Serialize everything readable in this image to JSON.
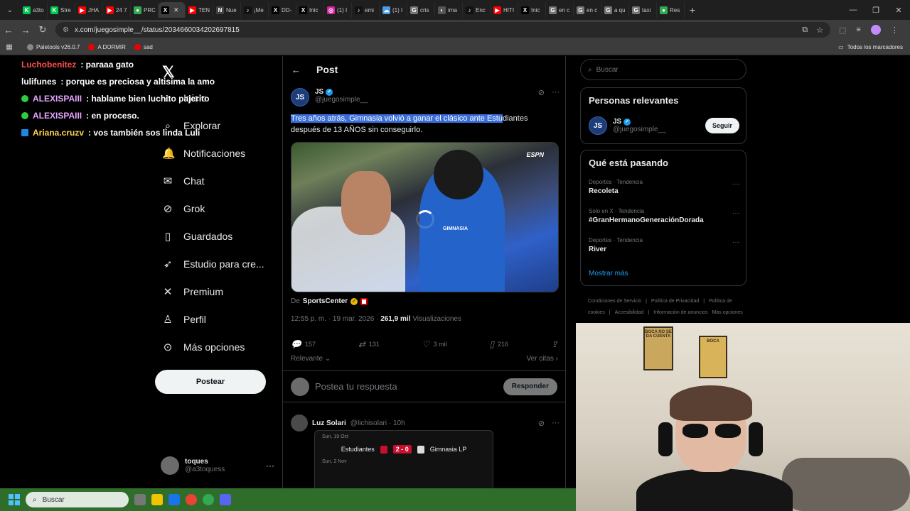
{
  "browser": {
    "tabs": [
      {
        "label": "a3to",
        "color": "#00c853",
        "glyph": "K"
      },
      {
        "label": "Stre",
        "color": "#00c853",
        "glyph": "K"
      },
      {
        "label": "JHA",
        "color": "#ff0000",
        "glyph": "▶"
      },
      {
        "label": "24 7",
        "color": "#ff0000",
        "glyph": "▶"
      },
      {
        "label": "PRC",
        "color": "#34a853",
        "glyph": "●"
      },
      {
        "label": "",
        "color": "#000000",
        "glyph": "X",
        "active": true
      },
      {
        "label": "TEN",
        "color": "#ff0000",
        "glyph": "▶"
      },
      {
        "label": "Nue",
        "color": "#444444",
        "glyph": "N"
      },
      {
        "label": "¡Me",
        "color": "#111111",
        "glyph": "♪"
      },
      {
        "label": "DD-",
        "color": "#000000",
        "glyph": "X"
      },
      {
        "label": "Inic",
        "color": "#000000",
        "glyph": "X"
      },
      {
        "label": "(1) I",
        "color": "#d6249f",
        "glyph": "◎"
      },
      {
        "label": "emi",
        "color": "#111111",
        "glyph": "♪"
      },
      {
        "label": "(1) I",
        "color": "#4b9ce2",
        "glyph": "☁"
      },
      {
        "label": "cris",
        "color": "#777777",
        "glyph": "G"
      },
      {
        "label": "ima",
        "color": "#555555",
        "glyph": "◐"
      },
      {
        "label": "Enc",
        "color": "#111111",
        "glyph": "♪"
      },
      {
        "label": "HITI",
        "color": "#ff0000",
        "glyph": "▶"
      },
      {
        "label": "Inic",
        "color": "#000000",
        "glyph": "X"
      },
      {
        "label": "en c",
        "color": "#777777",
        "glyph": "G"
      },
      {
        "label": "en c",
        "color": "#777777",
        "glyph": "G"
      },
      {
        "label": "a qu",
        "color": "#777777",
        "glyph": "G"
      },
      {
        "label": "taxi",
        "color": "#777777",
        "glyph": "G"
      },
      {
        "label": "Res",
        "color": "#34a853",
        "glyph": "●"
      }
    ],
    "url": "x.com/juegosimple__/status/2034660034202697815",
    "bookmarks": [
      {
        "label": "Paletools v26.0.7"
      },
      {
        "label": "A DORMIR"
      },
      {
        "label": "sad"
      }
    ],
    "all_bookmarks": "Todos los marcadores"
  },
  "chat": [
    {
      "user": "Luchobenitez",
      "msg": ": paraaa gato",
      "color": "#ff4d4d",
      "badge": ""
    },
    {
      "user": "lulifunes",
      "msg": ": porque es preciosa y altisima la amo",
      "color": "#ffffff",
      "badge": ""
    },
    {
      "user": "ALEXISPAIII",
      "msg": ": hablame bien luchito pajerito",
      "color": "#e5a6ff",
      "badge": "round"
    },
    {
      "user": "ALEXISPAIII",
      "msg": ": en proceso.",
      "color": "#e5a6ff",
      "badge": "round"
    },
    {
      "user": "Ariana.cruzv",
      "msg": ": vos también sos linda Luli",
      "color": "#ffd54f",
      "badge": "square"
    }
  ],
  "nav": {
    "items": [
      {
        "label": "Inicio",
        "icon": "home-icon",
        "glyph": "⌂"
      },
      {
        "label": "Explorar",
        "icon": "search-icon",
        "glyph": "⌕"
      },
      {
        "label": "Notificaciones",
        "icon": "bell-icon",
        "glyph": "🔔"
      },
      {
        "label": "Chat",
        "icon": "mail-icon",
        "glyph": "✉"
      },
      {
        "label": "Grok",
        "icon": "grok-icon",
        "glyph": "⊘"
      },
      {
        "label": "Guardados",
        "icon": "bookmark-icon",
        "glyph": "▯"
      },
      {
        "label": "Estudio para cre...",
        "icon": "rocket-icon",
        "glyph": "➶"
      },
      {
        "label": "Premium",
        "icon": "x-icon",
        "glyph": "✕"
      },
      {
        "label": "Perfil",
        "icon": "person-icon",
        "glyph": "♙"
      },
      {
        "label": "Más opciones",
        "icon": "more-circle-icon",
        "glyph": "⊙"
      }
    ],
    "post_button": "Postear",
    "user": {
      "name": "toques",
      "handle": "@a3toquess"
    }
  },
  "post": {
    "header_title": "Post",
    "author_name": "JS",
    "author_handle": "@juegosimple__",
    "text_selected": "Tres años atrás, Gimnasia volvió a ganar el clásico ante Estu",
    "text_rest": "diantes después de 13 AÑOS sin conseguirlo.",
    "media_label": "ESPN",
    "media_shirt": "GIMNASIA",
    "source_prefix": "De",
    "source_name": "SportsCenter",
    "time": "12:55 p. m. · 19 mar. 2026 ·",
    "views_count": "261,9 mil",
    "views_label": "Visualizaciones",
    "replies": "157",
    "reposts": "131",
    "likes": "3 mil",
    "bookmarks": "216",
    "sort": "Relevante",
    "quotes": "Ver citas",
    "reply_placeholder": "Postea tu respuesta",
    "reply_button": "Responder"
  },
  "reply": {
    "name": "Luz Solari",
    "handle": "@lichisolari · 10h",
    "card": {
      "date1": "Sun, 19 Oct",
      "home": "Estudiantes",
      "score": "2 - 0",
      "away": "Gimnasia LP",
      "date2": "Sun, 2 Nov"
    }
  },
  "right": {
    "search_placeholder": "Buscar",
    "people_title": "Personas relevantes",
    "person_name": "JS",
    "person_handle": "@juegosimple__",
    "follow_button": "Seguir",
    "trends_title": "Qué está pasando",
    "trends": [
      {
        "category": "Deportes · Tendencia",
        "title": "Recoleta"
      },
      {
        "category": "Solo en X · Tendencia",
        "title": "#GranHermanoGeneraciónDorada"
      },
      {
        "category": "Deportes · Tendencia",
        "title": "River"
      }
    ],
    "show_more": "Mostrar más",
    "footer": [
      "Condiciones de Servicio",
      "|",
      "Política de Privacidad",
      "|",
      "Política de cookies",
      "|",
      "Accesibilidad",
      "|",
      "Información de anuncios",
      "Más opciones ···"
    ]
  },
  "webcam": {
    "poster1": "BOCA NO SE DA CUENTA",
    "poster2": "BOCA"
  },
  "taskbar": {
    "search": "Buscar"
  }
}
